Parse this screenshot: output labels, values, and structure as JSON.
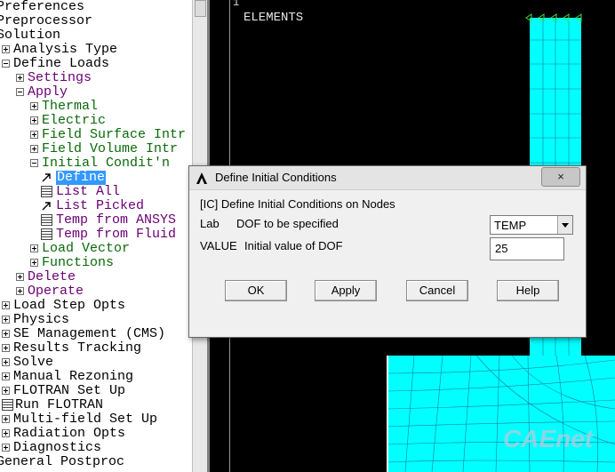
{
  "tree": {
    "items": [
      {
        "label": "Preferences",
        "color": "black"
      },
      {
        "label": "Preprocessor",
        "color": "black"
      },
      {
        "label": "Solution",
        "color": "black"
      },
      {
        "label": "Analysis Type",
        "color": "black"
      },
      {
        "label": "Define Loads",
        "color": "black"
      },
      {
        "label": "Settings",
        "color": "purple"
      },
      {
        "label": "Apply",
        "color": "purple"
      },
      {
        "label": "Thermal",
        "color": "green"
      },
      {
        "label": "Electric",
        "color": "green"
      },
      {
        "label": "Field Surface Intr",
        "color": "green"
      },
      {
        "label": "Field Volume Intr",
        "color": "green"
      },
      {
        "label": "Initial Condit'n",
        "color": "green"
      },
      {
        "label": "Define",
        "color": "selected"
      },
      {
        "label": "List All",
        "color": "purple"
      },
      {
        "label": "List Picked",
        "color": "purple"
      },
      {
        "label": "Temp from ANSYS",
        "color": "purple"
      },
      {
        "label": "Temp from Fluid",
        "color": "purple"
      },
      {
        "label": "Load Vector",
        "color": "green"
      },
      {
        "label": "Functions",
        "color": "green"
      },
      {
        "label": "Delete",
        "color": "purple"
      },
      {
        "label": "Operate",
        "color": "purple"
      },
      {
        "label": "Load Step Opts",
        "color": "black"
      },
      {
        "label": "Physics",
        "color": "black"
      },
      {
        "label": "SE Management (CMS)",
        "color": "black"
      },
      {
        "label": "Results Tracking",
        "color": "black"
      },
      {
        "label": "Solve",
        "color": "black"
      },
      {
        "label": "Manual Rezoning",
        "color": "black"
      },
      {
        "label": "FLOTRAN Set Up",
        "color": "black"
      },
      {
        "label": "Run FLOTRAN",
        "color": "black"
      },
      {
        "label": "Multi-field Set Up",
        "color": "black"
      },
      {
        "label": "Radiation Opts",
        "color": "black"
      },
      {
        "label": "Diagnostics",
        "color": "black"
      },
      {
        "label": "General Postproc",
        "color": "black"
      }
    ]
  },
  "graphics": {
    "number_mark": "1",
    "elements_label": "ELEMENTS",
    "mesh_color": "#00ffff",
    "watermark": "CAEnet"
  },
  "dialog": {
    "title": "Define Initial Conditions",
    "close_label": "×",
    "header": "[IC]  Define Initial Conditions on Nodes",
    "lab_key": "Lab",
    "lab_desc": "DOF to be specified",
    "lab_value": "TEMP",
    "value_key": "VALUE",
    "value_desc": "Initial value of DOF",
    "value_input": "25",
    "buttons": {
      "ok": "OK",
      "apply": "Apply",
      "cancel": "Cancel",
      "help": "Help"
    }
  }
}
